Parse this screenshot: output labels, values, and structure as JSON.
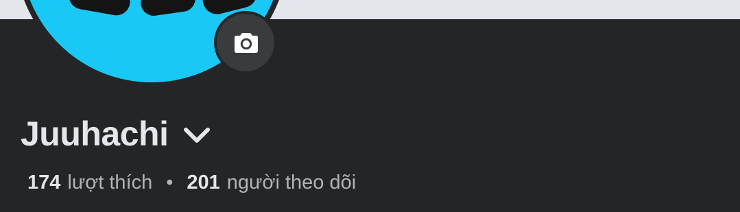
{
  "profile": {
    "name": "Juuhachi",
    "likes_count": "174",
    "likes_label": "lượt thích",
    "separator": "•",
    "followers_count": "201",
    "followers_label": "người theo dõi"
  },
  "icons": {
    "camera": "camera-icon",
    "name_menu": "chevron-down-icon"
  },
  "colors": {
    "background": "#242526",
    "cover": "#e4e6eb",
    "avatar": "#1ac8f5",
    "camera_button": "#3a3b3c",
    "primary_text": "#e4e6eb",
    "secondary_text": "#b0b3b8"
  }
}
